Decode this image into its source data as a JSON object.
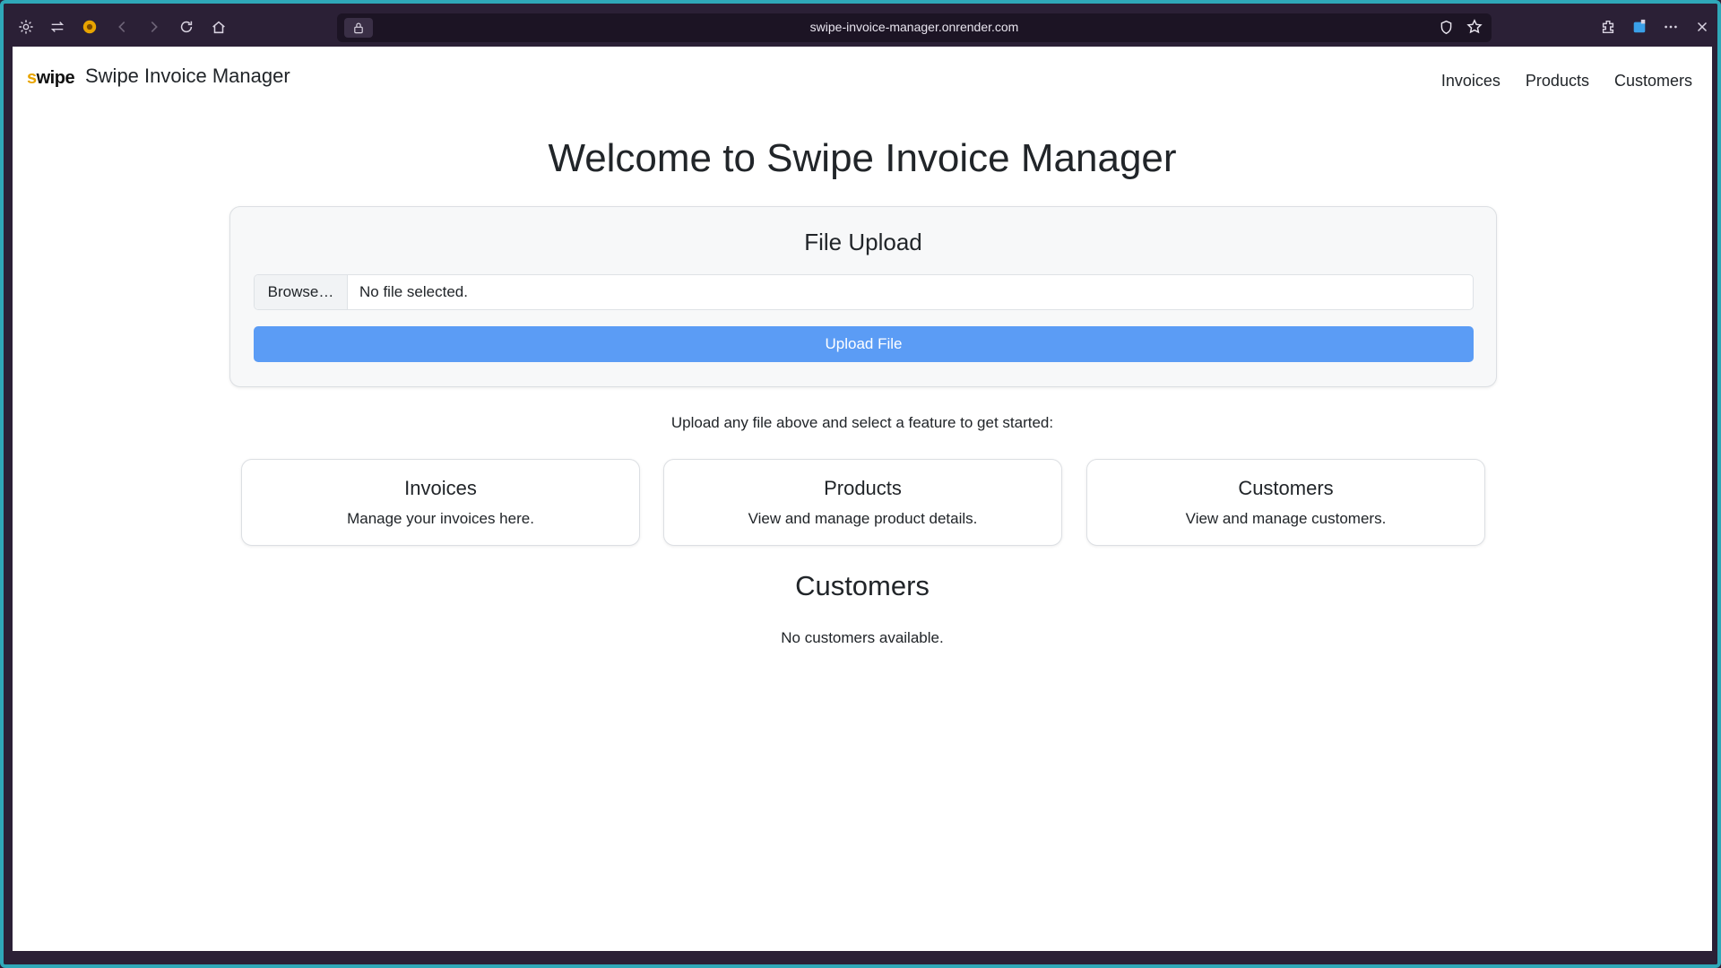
{
  "browser": {
    "url": "swipe-invoice-manager.onrender.com"
  },
  "app": {
    "logo_text_a": "s",
    "logo_text_b": "wipe",
    "title": "Swipe Invoice Manager",
    "nav": [
      "Invoices",
      "Products",
      "Customers"
    ]
  },
  "main": {
    "welcome": "Welcome to Swipe Invoice Manager",
    "upload": {
      "heading": "File Upload",
      "browse_label": "Browse…",
      "file_status": "No file selected.",
      "upload_button": "Upload File"
    },
    "hint": "Upload any file above and select a feature to get started:",
    "features": [
      {
        "title": "Invoices",
        "description": "Manage your invoices here."
      },
      {
        "title": "Products",
        "description": "View and manage product details."
      },
      {
        "title": "Customers",
        "description": "View and manage customers."
      }
    ],
    "section_title": "Customers",
    "empty_message": "No customers available."
  },
  "colors": {
    "accent": "#5b9cf5",
    "frame": "#2fa8b8",
    "chrome": "#2b2036"
  }
}
